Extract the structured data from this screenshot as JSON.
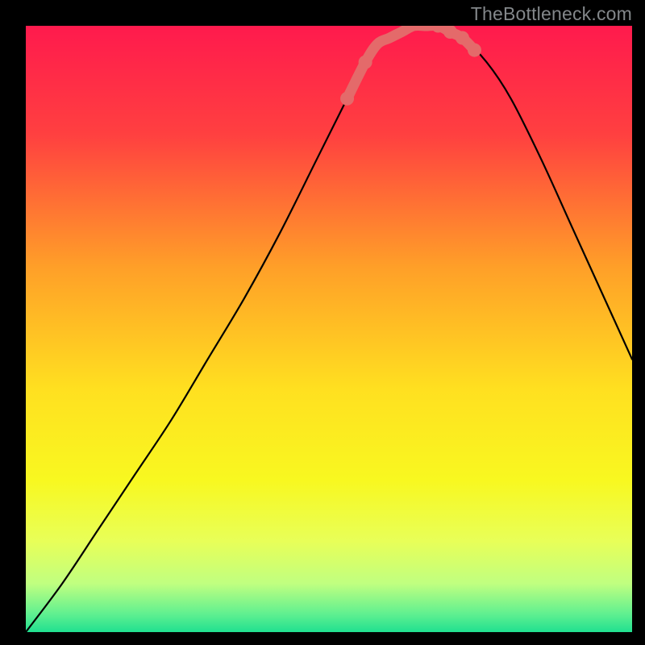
{
  "watermark": "TheBottleneck.com",
  "chart_data": {
    "type": "line",
    "title": "",
    "xlabel": "",
    "ylabel": "",
    "xlim": [
      0,
      100
    ],
    "ylim": [
      0,
      100
    ],
    "note": "Bottleneck-style curve over a vertical red→yellow→green gradient. No axis ticks or labels are visible; x and y values are estimated on a 0–100 canvas scale.",
    "gradient_stops": [
      {
        "offset": 0,
        "color": "#ff1a4d"
      },
      {
        "offset": 18,
        "color": "#ff4040"
      },
      {
        "offset": 40,
        "color": "#ffa028"
      },
      {
        "offset": 60,
        "color": "#ffe020"
      },
      {
        "offset": 75,
        "color": "#f8f820"
      },
      {
        "offset": 85,
        "color": "#e8ff58"
      },
      {
        "offset": 92,
        "color": "#c0ff80"
      },
      {
        "offset": 97,
        "color": "#60f090"
      },
      {
        "offset": 100,
        "color": "#20e090"
      }
    ],
    "series": [
      {
        "name": "bottleneck-curve",
        "stroke": "#000000",
        "x": [
          0,
          6,
          12,
          18,
          24,
          30,
          36,
          42,
          48,
          53,
          56,
          60,
          64,
          68,
          72,
          76,
          80,
          85,
          90,
          95,
          100
        ],
        "y": [
          100,
          92,
          83,
          74,
          65,
          55,
          45,
          34,
          22,
          12,
          6,
          2,
          0,
          0,
          2,
          6,
          12,
          22,
          33,
          44,
          55
        ]
      },
      {
        "name": "highlight-dots",
        "stroke": "#e46a6a",
        "marker": "circle",
        "x": [
          53,
          56,
          58,
          60,
          62,
          64,
          66,
          68,
          70,
          72,
          74
        ],
        "y": [
          12,
          6,
          3,
          2,
          1,
          0,
          0,
          0,
          1,
          2,
          4
        ]
      }
    ]
  }
}
